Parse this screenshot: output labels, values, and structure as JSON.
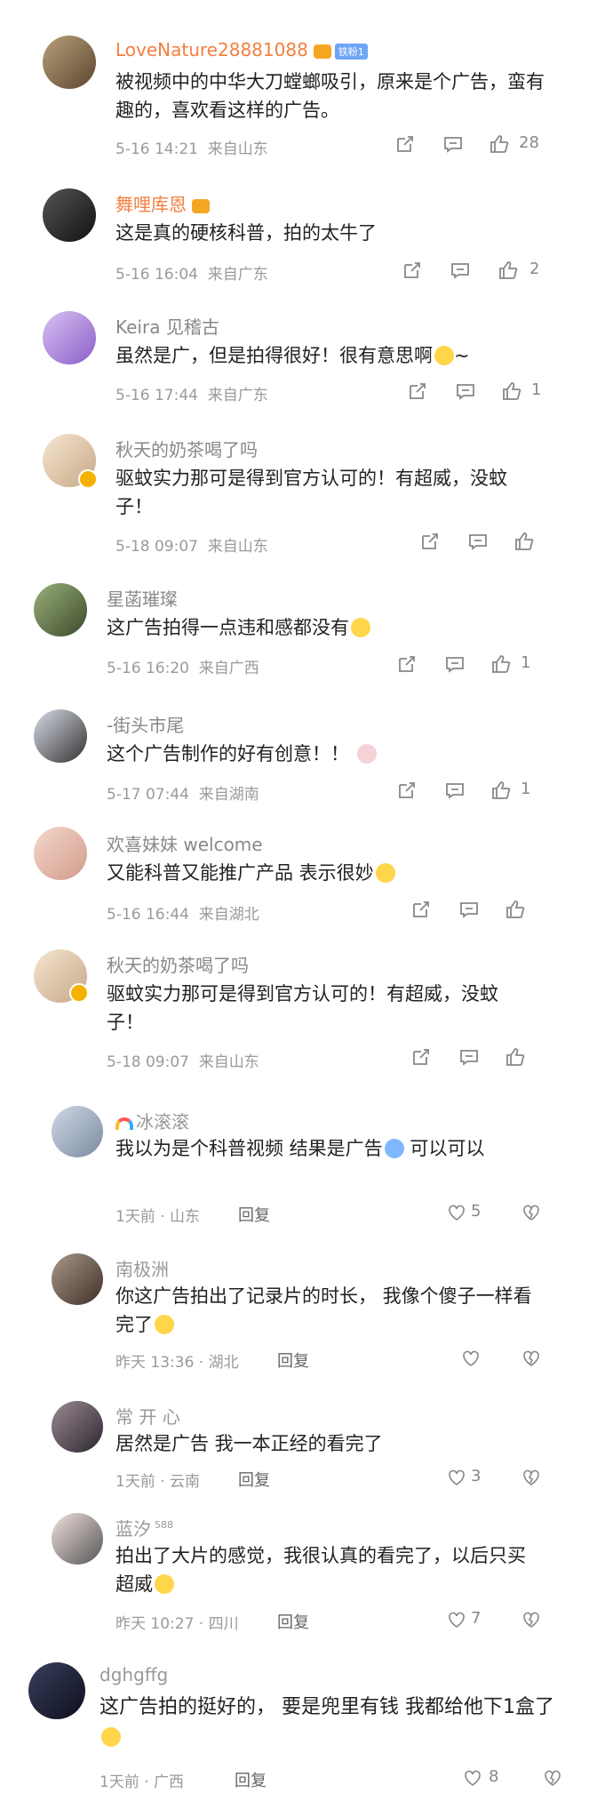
{
  "comments": [
    {
      "name": "LoveNature28881088",
      "badge": "铁粉1",
      "text": "被视频中的中华大刀螳螂吸引，原来是个广告，蛮有趣的，喜欢看这样的广告。",
      "time": "5-16 14:21",
      "loc": "来自山东",
      "likes": "28"
    },
    {
      "name": "舞哩库恩",
      "text": "这是真的硬核科普，拍的太牛了",
      "time": "5-16 16:04",
      "loc": "来自广东",
      "likes": "2"
    },
    {
      "name": "Keira 见稽古",
      "text": "虽然是广，但是拍得很好！很有意思啊",
      "tail": "~",
      "time": "5-16 17:44",
      "loc": "来自广东",
      "likes": "1"
    },
    {
      "name": "秋天的奶茶喝了吗",
      "text": "驱蚊实力那可是得到官方认可的！有超威，没蚊子！",
      "time": "5-18 09:07",
      "loc": "来自山东",
      "likes": ""
    },
    {
      "name": "星菡璀璨",
      "text": "这广告拍得一点违和感都没有",
      "time": "5-16 16:20",
      "loc": "来自广西",
      "likes": "1"
    },
    {
      "name": "-街头市尾",
      "text": "这个广告制作的好有创意！！",
      "time": "5-17 07:44",
      "loc": "来自湖南",
      "likes": "1"
    },
    {
      "name": "欢喜妹妹 welcome",
      "text": "又能科普又能推广产品 表示很妙",
      "time": "5-16 16:44",
      "loc": "来自湖北",
      "likes": ""
    },
    {
      "name": "秋天的奶茶喝了吗",
      "text": "驱蚊实力那可是得到官方认可的！有超威，没蚊子！",
      "time": "5-18 09:07",
      "loc": "来自山东",
      "likes": ""
    }
  ],
  "replies": [
    {
      "name": "冰滚滚",
      "text": "我以为是个科普视频  结果是广告",
      "tail": "  可以可以",
      "meta": "1天前 · 山东",
      "reply": "回复",
      "likes": "5"
    },
    {
      "name": "南极洲",
      "text": "你这广告拍出了记录片的时长， 我像个傻子一样看完了",
      "meta": "昨天 13:36 · 湖北",
      "reply": "回复",
      "likes": ""
    },
    {
      "name": "常 开 心",
      "text": "居然是广告  我一本正经的看完了",
      "meta": "1天前 · 云南",
      "reply": "回复",
      "likes": "3"
    },
    {
      "name": "蓝汐",
      "sub": "588",
      "text": "拍出了大片的感觉，我很认真的看完了，以后只买超威",
      "meta": "昨天 10:27 · 四川",
      "reply": "回复",
      "likes": "7"
    },
    {
      "name": "dghgffg",
      "text": "这广告拍的挺好的， 要是兜里有钱 我都给他下1盒了",
      "meta": "1天前 · 广西",
      "reply": "回复",
      "likes": "8"
    }
  ],
  "colors": {
    "name_orange": "#f27f3f",
    "meta": "#9a9a9a",
    "text": "#222222"
  }
}
